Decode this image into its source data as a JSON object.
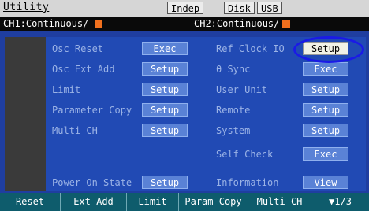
{
  "titlebar": {
    "title": "Utility",
    "indep": "Indep",
    "disk": "Disk",
    "usb": "USB"
  },
  "channels": {
    "ch1": "CH1:Continuous/",
    "ch2": "CH2:Continuous/",
    "swatch_color": "#f0701e"
  },
  "left_column": [
    {
      "label": "Osc Reset",
      "button": "Exec"
    },
    {
      "label": "Osc Ext Add",
      "button": "Setup"
    },
    {
      "label": "Limit",
      "button": "Setup"
    },
    {
      "label": "Parameter Copy",
      "button": "Setup"
    },
    {
      "label": "Multi CH",
      "button": "Setup"
    },
    {
      "label": "Power-On State",
      "button": "Setup"
    }
  ],
  "right_column": [
    {
      "label": "Ref Clock IO",
      "button": "Setup"
    },
    {
      "label": "θ Sync",
      "button": "Exec"
    },
    {
      "label": "User Unit",
      "button": "Setup"
    },
    {
      "label": "Remote",
      "button": "Setup"
    },
    {
      "label": "System",
      "button": "Setup"
    },
    {
      "label": "Self Check",
      "button": "Exec"
    },
    {
      "label": "Information",
      "button": "View"
    }
  ],
  "softkeys": [
    "Reset",
    "Ext Add",
    "Limit",
    "Param Copy",
    "Multi CH",
    "▼1/3"
  ],
  "colors": {
    "panel_bg": "#214ab4",
    "button_bg": "#5a82d6",
    "label_text": "#9bb3e6",
    "highlight_circle": "#1a1ae6",
    "softkey_bar": "#0e5c6c"
  }
}
